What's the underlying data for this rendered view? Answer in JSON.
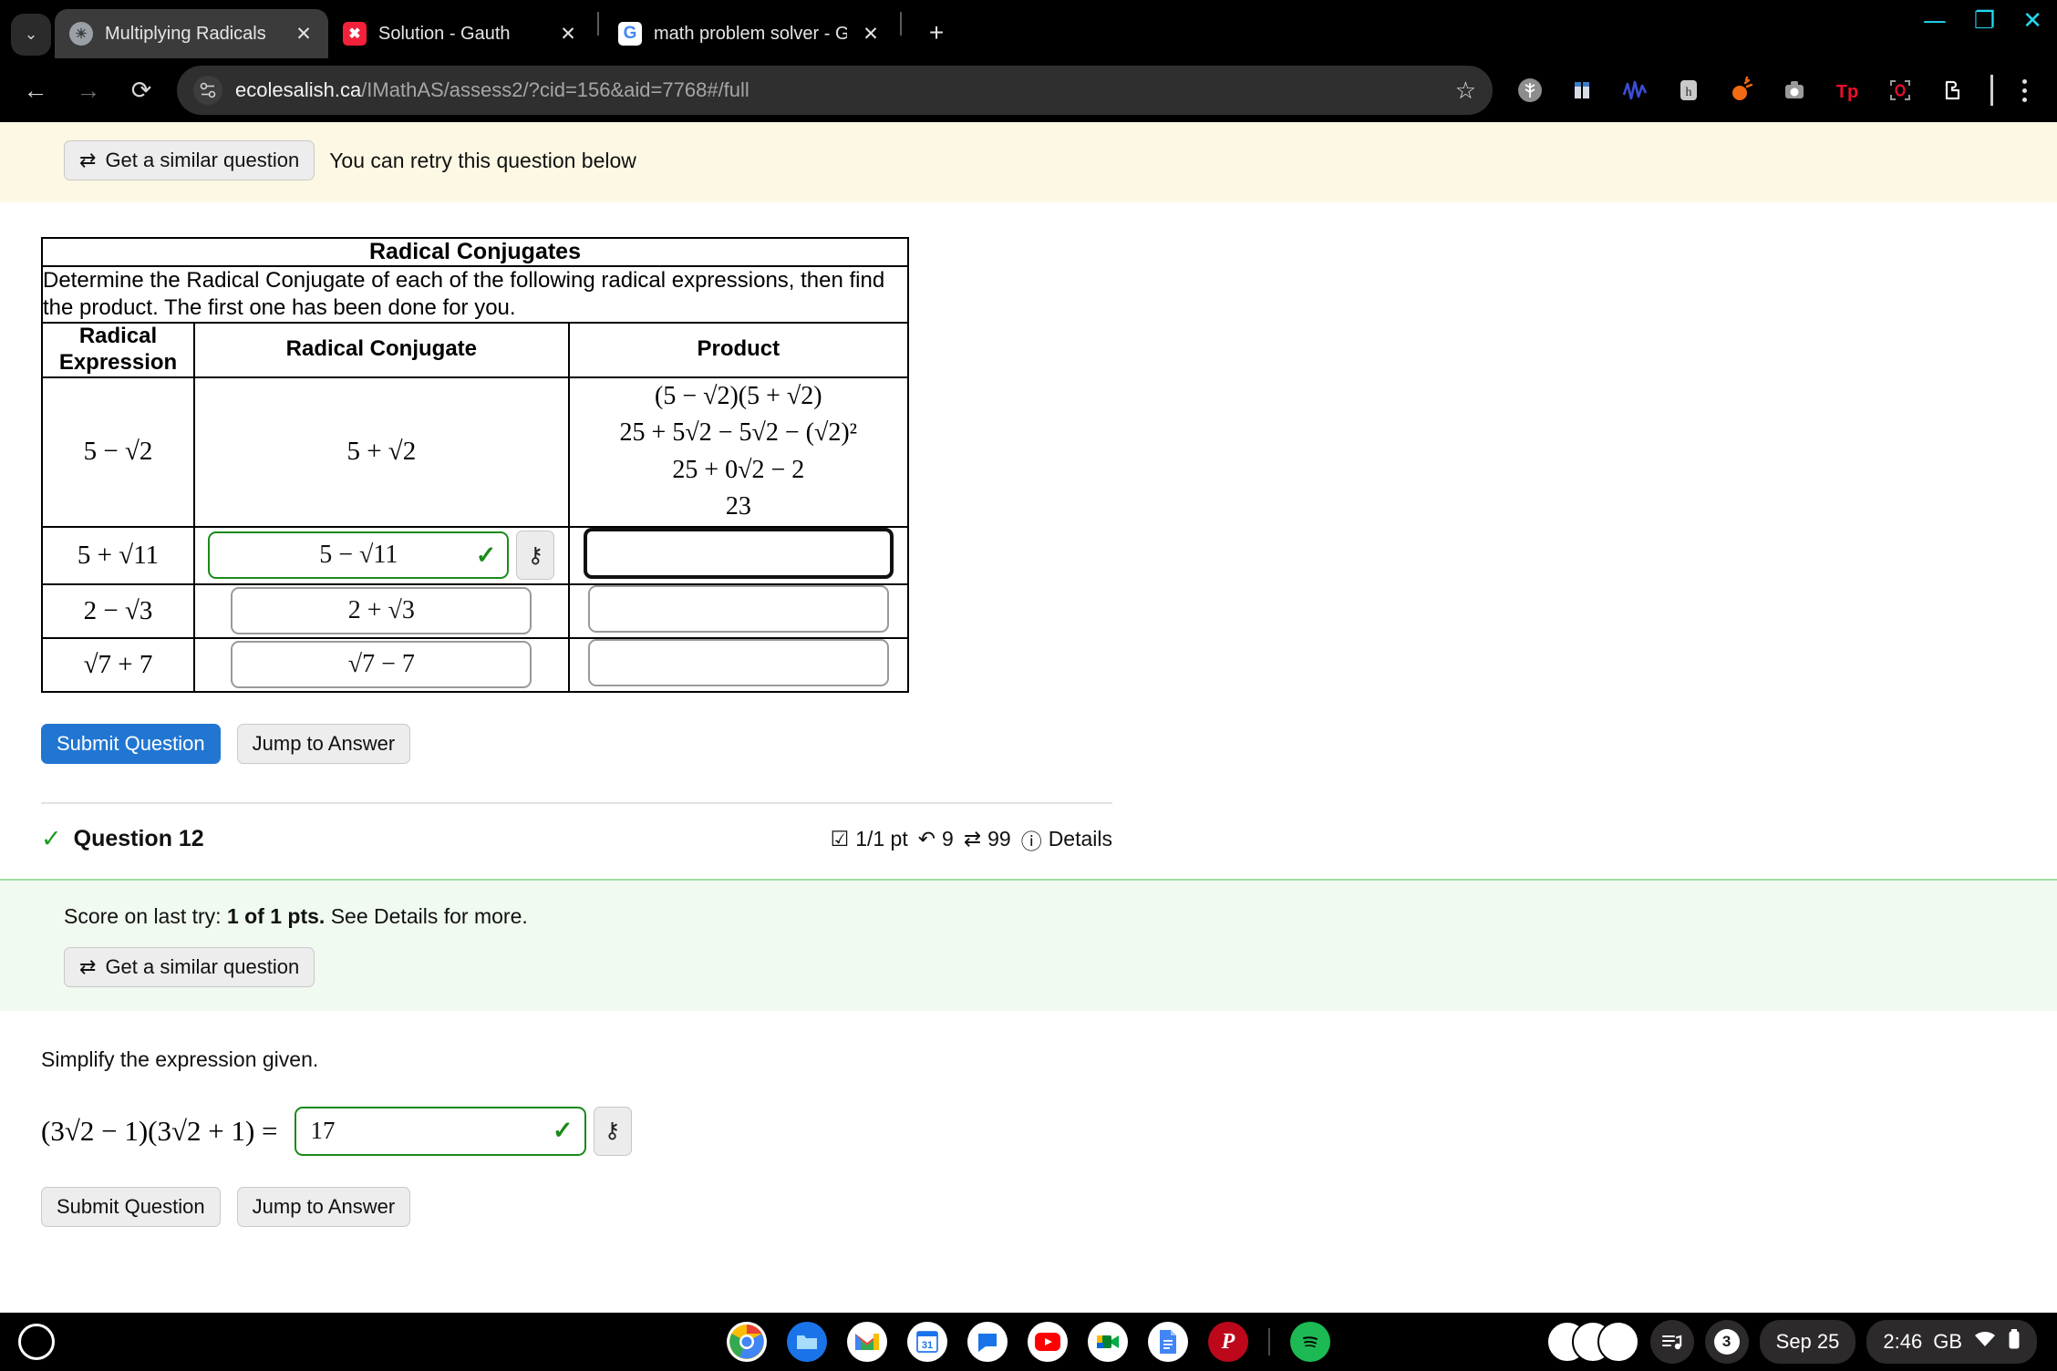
{
  "browser": {
    "tabs": [
      {
        "title": "Multiplying Radicals",
        "favicon": "globe-icon",
        "active": true
      },
      {
        "title": "Solution - Gauth",
        "favicon": "gauth-icon",
        "active": false
      },
      {
        "title": "math problem solver - Google S",
        "favicon": "google-icon",
        "active": false
      }
    ],
    "new_tab_label": "+",
    "tab_search_label": "⌄",
    "window_controls": {
      "minimize": "—",
      "restore": "❐",
      "close": "✕"
    },
    "nav": {
      "back": "←",
      "forward": "→",
      "reload": "⟳"
    },
    "url": {
      "domain": "ecolesalish.ca",
      "path": "/IMathAS/assess2/?cid=156&aid=7768#/full"
    },
    "bookmark_label": "☆",
    "extensions": [
      "tree-extension-icon",
      "columns-extension-icon",
      "waveform-extension-icon",
      "h-extension-icon",
      "paint-blob-extension-icon",
      "camera-extension-icon",
      "tp-extension-icon",
      "scan-extension-icon",
      "puzzle-extensions-icon"
    ],
    "menu_label": "kebab-menu"
  },
  "alert": {
    "button_label": "Get a similar question",
    "button_icon": "⇄",
    "message": "You can retry this question below"
  },
  "table": {
    "title": "Radical Conjugates",
    "instructions": "Determine the Radical Conjugate of each of the following radical expressions, then find the product. The first one has been done for you.",
    "headers": [
      "Radical Expression",
      "Radical Conjugate",
      "Product"
    ],
    "rows": [
      {
        "expression": "5 − √2",
        "conjugate": "5 + √2",
        "conjugate_is_input": false,
        "product_lines": [
          "(5 − √2)(5 + √2)",
          "25 + 5√2 − 5√2 − (√2)²",
          "25 + 0√2 − 2",
          "23"
        ],
        "product_is_input": false
      },
      {
        "expression": "5 + √11",
        "conjugate_value": "5 − √11",
        "conjugate_is_input": true,
        "conjugate_correct": true,
        "product_value": "",
        "product_is_input": true,
        "product_focused": true
      },
      {
        "expression": "2 − √3",
        "conjugate_value": "2 + √3",
        "conjugate_is_input": true,
        "conjugate_correct": false,
        "product_value": "",
        "product_is_input": true,
        "product_focused": false
      },
      {
        "expression": "√7 + 7",
        "conjugate_value": "√7 − 7",
        "conjugate_is_input": true,
        "conjugate_correct": false,
        "product_value": "",
        "product_is_input": true,
        "product_focused": false
      }
    ],
    "keyboard_icon": "⚷"
  },
  "actions_top": {
    "submit": "Submit Question",
    "jump": "Jump to Answer"
  },
  "question12": {
    "check_icon": "✓",
    "title": "Question 12",
    "points": "1/1 pt",
    "attempts": "9",
    "retries": "99",
    "details": "Details",
    "score_prefix": "Score on last try:",
    "score_value": "1 of 1 pts.",
    "score_suffix": "See Details for more.",
    "similar_button": "Get a similar question",
    "prompt": "Simplify the expression given.",
    "expression": "(3√2 − 1)(3√2 + 1) =",
    "answer_value": "17",
    "answer_correct": true,
    "submit": "Submit Question",
    "jump": "Jump to Answer"
  },
  "shelf": {
    "launcher": "launcher-circle",
    "apps": [
      "chrome-icon",
      "files-icon",
      "gmail-icon",
      "calendar-icon",
      "chat-icon",
      "youtube-icon",
      "meet-icon",
      "docs-icon",
      "pinterest-icon",
      "spotify-icon"
    ],
    "notification_count": "3",
    "date": "Sep 25",
    "time": "2:46",
    "locale": "GB",
    "wifi": "wifi-icon",
    "battery": "battery-icon"
  },
  "colors": {
    "accent_blue": "#2176d2",
    "correct_green": "#1a8a1a",
    "alert_yellow": "#fcf8e3",
    "panel_green": "#f0faf0",
    "window_control_cyan": "#23d9f0"
  }
}
